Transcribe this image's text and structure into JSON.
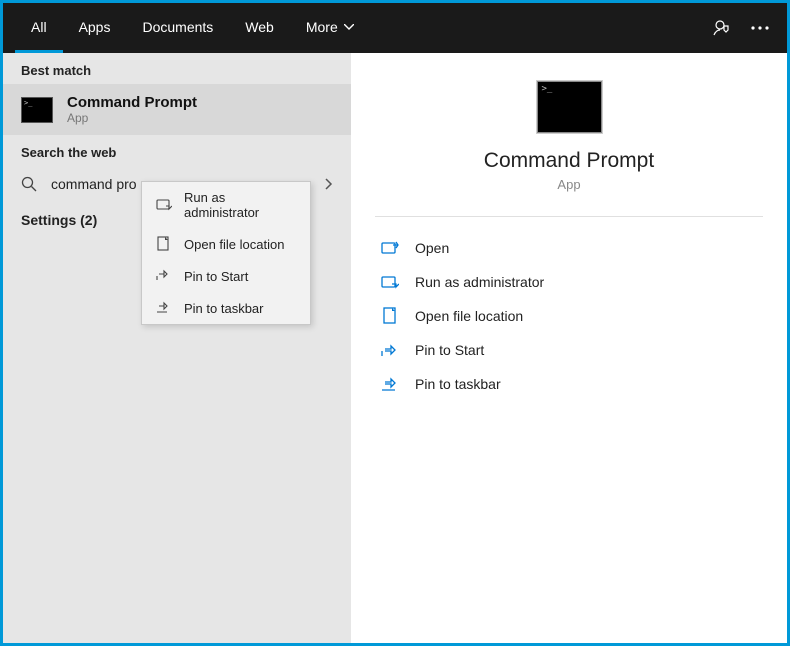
{
  "header": {
    "tabs": [
      "All",
      "Apps",
      "Documents",
      "Web",
      "More"
    ]
  },
  "left": {
    "best_match_label": "Best match",
    "item_title": "Command Prompt",
    "item_sub": "App",
    "search_web_label": "Search the web",
    "web_query": "command pro",
    "settings_label": "Settings (2)"
  },
  "context_menu": {
    "run_admin": "Run as administrator",
    "open_loc": "Open file location",
    "pin_start": "Pin to Start",
    "pin_taskbar": "Pin to taskbar"
  },
  "preview": {
    "title": "Command Prompt",
    "sub": "App"
  },
  "actions": {
    "open": "Open",
    "run_admin": "Run as administrator",
    "open_loc": "Open file location",
    "pin_start": "Pin to Start",
    "pin_taskbar": "Pin to taskbar"
  }
}
